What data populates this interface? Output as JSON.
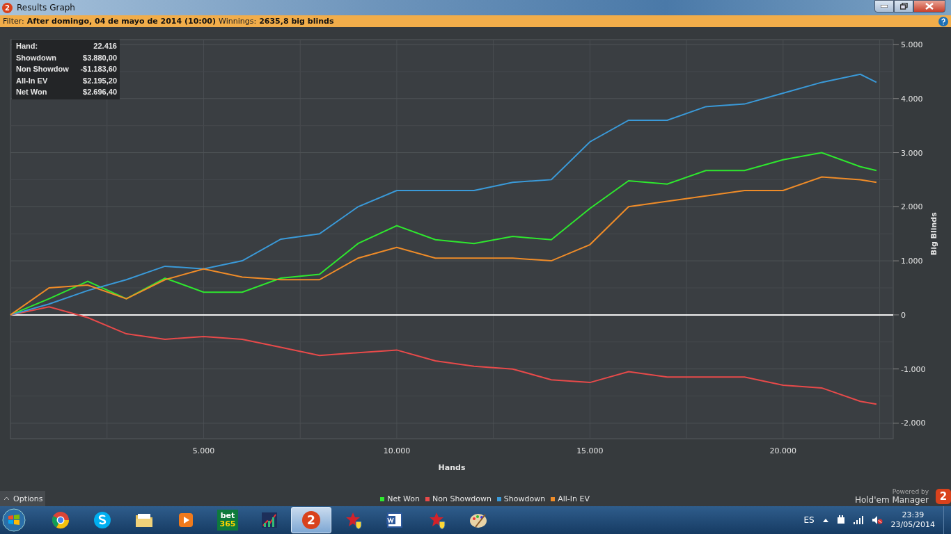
{
  "window": {
    "logo_text": "2",
    "title": "Results Graph"
  },
  "filter_bar": {
    "filter_label": "Filter:",
    "filter_value": "After domingo, 04 de mayo de 2014 (10:00)",
    "winnings_label": "Winnings:",
    "winnings_value": "2635,8 big blinds"
  },
  "info_box": {
    "rows": [
      {
        "label": "Hand:",
        "value": "22.416"
      },
      {
        "label": "Showdown",
        "value": "$3.880,00"
      },
      {
        "label": "Non Showdow",
        "value": "-$1.183,60"
      },
      {
        "label": "All-In EV",
        "value": "$2.195,20"
      },
      {
        "label": "Net Won",
        "value": "$2.696,40"
      }
    ]
  },
  "chart": {
    "chart_data": {
      "type": "line",
      "xlabel": "Hands",
      "ylabel": "Big Blinds",
      "grid": true,
      "x": [
        0,
        1000,
        2000,
        3000,
        4000,
        5000,
        6000,
        7000,
        8000,
        9000,
        10000,
        11000,
        12000,
        13000,
        14000,
        15000,
        16000,
        17000,
        18000,
        19000,
        20000,
        21000,
        22000,
        22416
      ],
      "series": [
        {
          "name": "Net Won",
          "color": "#2ee82e",
          "values": [
            0,
            300,
            620,
            300,
            680,
            420,
            420,
            680,
            750,
            1320,
            1650,
            1390,
            1320,
            1450,
            1390,
            1970,
            2480,
            2420,
            2670,
            2670,
            2870,
            3000,
            2740,
            2670
          ]
        },
        {
          "name": "Non Showdown",
          "color": "#e84a4a",
          "values": [
            0,
            150,
            -50,
            -350,
            -450,
            -400,
            -450,
            -600,
            -750,
            -700,
            -650,
            -850,
            -950,
            -1000,
            -1200,
            -1250,
            -1050,
            -1150,
            -1150,
            -1150,
            -1300,
            -1350,
            -1600,
            -1650
          ]
        },
        {
          "name": "Showdown",
          "color": "#3a9ad9",
          "values": [
            0,
            200,
            450,
            650,
            900,
            850,
            1000,
            1400,
            1500,
            2000,
            2300,
            2300,
            2300,
            2450,
            2500,
            3200,
            3600,
            3600,
            3850,
            3900,
            4100,
            4300,
            4450,
            4300
          ]
        },
        {
          "name": "All-In EV",
          "color": "#f08c28",
          "values": [
            0,
            500,
            550,
            300,
            650,
            850,
            700,
            650,
            650,
            1050,
            1250,
            1050,
            1050,
            1050,
            1000,
            1300,
            2000,
            2100,
            2200,
            2300,
            2300,
            2550,
            2500,
            2450
          ]
        }
      ],
      "xlim": [
        0,
        22850
      ],
      "ylim": [
        -2290,
        5090
      ],
      "xticks": [
        {
          "value": 5000,
          "label": "5.000"
        },
        {
          "value": 10000,
          "label": "10.000"
        },
        {
          "value": 15000,
          "label": "15.000"
        },
        {
          "value": 20000,
          "label": "20.000"
        }
      ],
      "yticks": [
        {
          "value": -2000,
          "label": "-2.000"
        },
        {
          "value": -1000,
          "label": "-1.000"
        },
        {
          "value": 0,
          "label": "0"
        },
        {
          "value": 1000,
          "label": "1.000"
        },
        {
          "value": 2000,
          "label": "2.000"
        },
        {
          "value": 3000,
          "label": "3.000"
        },
        {
          "value": 4000,
          "label": "4.000"
        },
        {
          "value": 5000,
          "label": "5.000"
        }
      ]
    }
  },
  "footer": {
    "options_label": "Options",
    "powered_by": "Powered by",
    "product": "Hold'em Manager",
    "product_logo_text": "2"
  },
  "taskbar": {
    "apps": [
      {
        "kind": "chrome",
        "selected": false
      },
      {
        "kind": "skype",
        "selected": false
      },
      {
        "kind": "folder",
        "selected": false
      },
      {
        "kind": "media",
        "selected": false
      },
      {
        "kind": "bet",
        "selected": false,
        "lines": [
          "bet",
          "365"
        ]
      },
      {
        "kind": "chart",
        "selected": false
      },
      {
        "kind": "hm2",
        "selected": true,
        "text": "2"
      },
      {
        "kind": "poker",
        "selected": false
      },
      {
        "kind": "word",
        "selected": false
      },
      {
        "kind": "poker",
        "selected": false
      },
      {
        "kind": "paint",
        "selected": false
      }
    ],
    "language": "ES",
    "time": "23:39",
    "date": "23/05/2014"
  }
}
